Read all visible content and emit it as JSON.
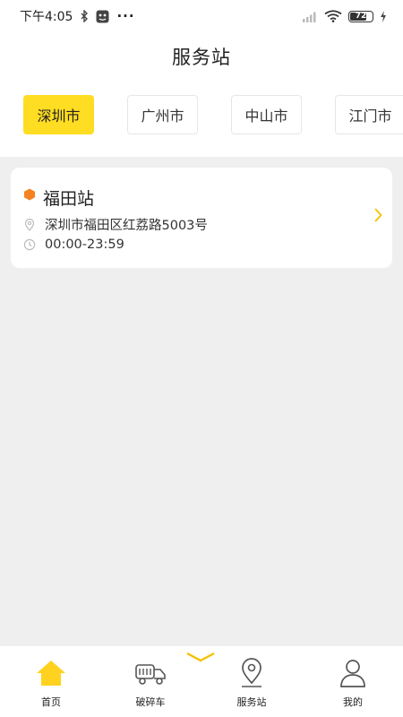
{
  "status_bar": {
    "time": "下午4:05",
    "more": "···",
    "battery": "72"
  },
  "page_title": "服务站",
  "city_tabs": [
    {
      "label": "深圳市",
      "active": true
    },
    {
      "label": "广州市",
      "active": false
    },
    {
      "label": "中山市",
      "active": false
    },
    {
      "label": "江门市",
      "active": false
    }
  ],
  "stations": [
    {
      "name": "福田站",
      "address": "深圳市福田区红荔路5003号",
      "hours": "00:00-23:59"
    }
  ],
  "bottom_nav": [
    {
      "label": "首页",
      "icon": "home-icon",
      "active": true
    },
    {
      "label": "破碎车",
      "icon": "truck-icon",
      "active": false
    },
    {
      "label": "服务站",
      "icon": "location-pin-icon",
      "active": false
    },
    {
      "label": "我的",
      "icon": "user-icon",
      "active": false
    }
  ],
  "colors": {
    "accent": "#ffdd22",
    "station_marker": "#f58220",
    "background": "#efefef"
  }
}
